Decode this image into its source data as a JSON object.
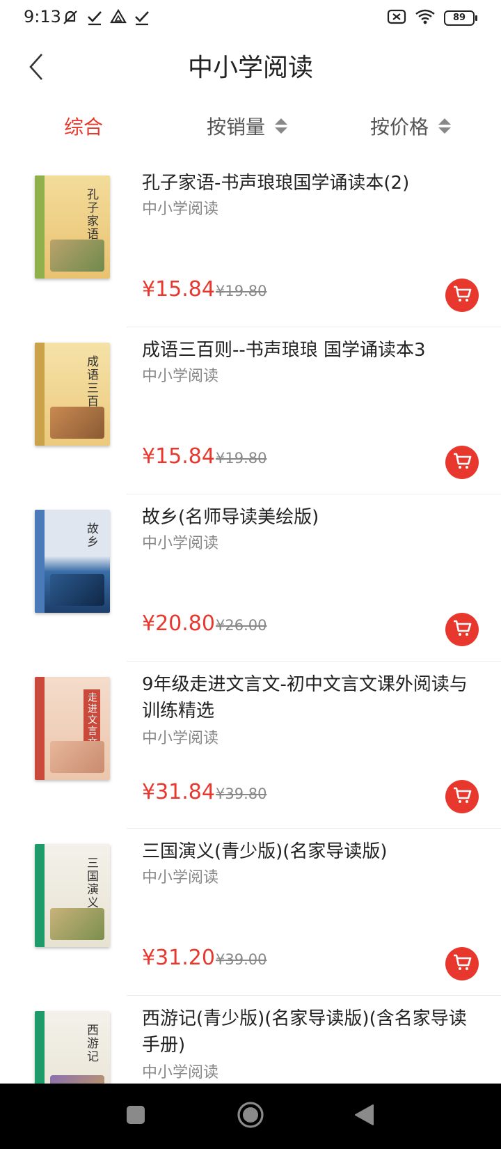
{
  "status_bar": {
    "time": "9:13",
    "battery": "89",
    "left_icons": [
      "notification-muted-icon",
      "check-icon",
      "drive-icon",
      "check-icon"
    ],
    "right_icons": [
      "no-sim-icon",
      "wifi-icon",
      "battery-icon"
    ]
  },
  "header": {
    "title": "中小学阅读",
    "back_icon": "chevron-left-icon"
  },
  "sort_bar": {
    "tabs": [
      {
        "label": "综合",
        "active": true
      },
      {
        "label": "按销量",
        "active": false
      },
      {
        "label": "按价格",
        "active": false
      }
    ]
  },
  "colors": {
    "accent": "#e8382e",
    "secondary_text": "#888888",
    "primary_text": "#222222"
  },
  "products": [
    {
      "name": "孔子家语-书声琅琅国学诵读本(2)",
      "category": "中小学阅读",
      "price": "¥15.84",
      "original_price": "¥19.80",
      "cover_title": "孔子家语"
    },
    {
      "name": "成语三百则--书声琅琅 国学诵读本3",
      "category": "中小学阅读",
      "price": "¥15.84",
      "original_price": "¥19.80",
      "cover_title": "成语三百则"
    },
    {
      "name": "故乡(名师导读美绘版)",
      "category": "中小学阅读",
      "price": "¥20.80",
      "original_price": "¥26.00",
      "cover_title": "故乡"
    },
    {
      "name": "9年级走进文言文-初中文言文课外阅读与训练精选",
      "category": "中小学阅读",
      "price": "¥31.84",
      "original_price": "¥39.80",
      "cover_title": "走进文言文"
    },
    {
      "name": "三国演义(青少版)(名家导读版)",
      "category": "中小学阅读",
      "price": "¥31.20",
      "original_price": "¥39.00",
      "cover_title": "三国演义"
    },
    {
      "name": "西游记(青少版)(名家导读版)(含名家导读手册)",
      "category": "中小学阅读",
      "price": "",
      "original_price": "",
      "cover_title": "西游记"
    }
  ],
  "nav_bar": {
    "icons": [
      "recents-square-icon",
      "home-circle-icon",
      "back-triangle-icon"
    ]
  }
}
